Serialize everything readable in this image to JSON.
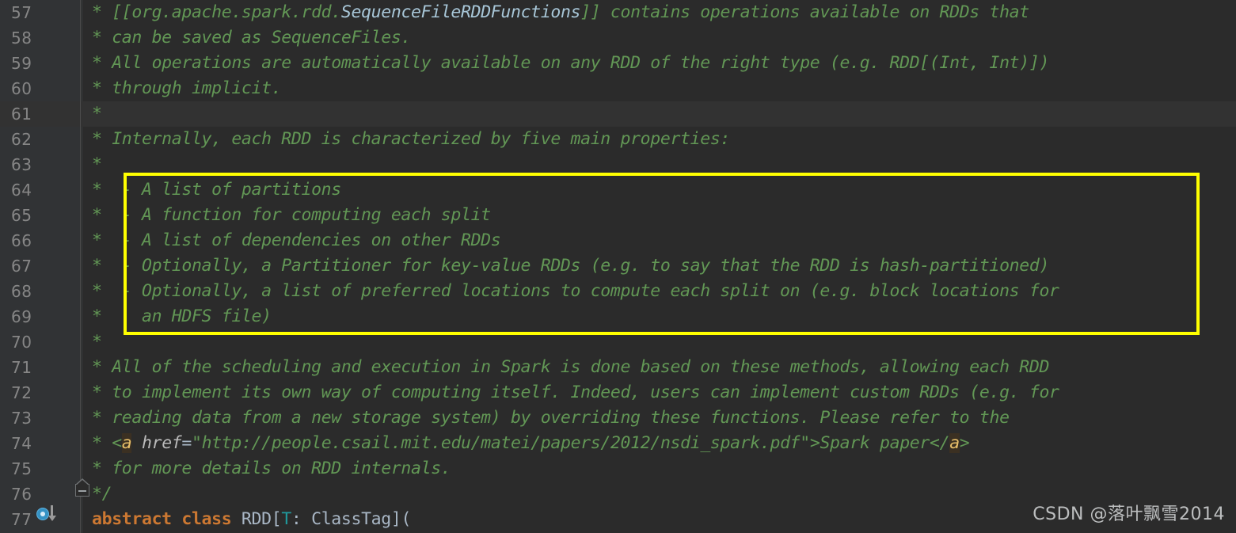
{
  "editor": {
    "background_color": "#2b2b2b",
    "gutter_color": "#313335",
    "current_line_color": "#323232",
    "comment_color": "#629755",
    "keyword_color": "#cc7832",
    "identifier_color": "#a9b7c6",
    "type_param_color": "#20999d",
    "highlight_box_color": "#ffff00",
    "first_line_number": 57,
    "last_line_number": 77,
    "current_line_number": 61
  },
  "lines": [
    {
      "no": "57",
      "text": "* [[org.apache.spark.rdd.SequenceFileRDDFunctions]] contains operations available on RDDs that"
    },
    {
      "no": "58",
      "text": "* can be saved as SequenceFiles."
    },
    {
      "no": "59",
      "text": "* All operations are automatically available on any RDD of the right type (e.g. RDD[(Int, Int)])"
    },
    {
      "no": "60",
      "text": "* through implicit."
    },
    {
      "no": "61",
      "text": "*"
    },
    {
      "no": "62",
      "text": "* Internally, each RDD is characterized by five main properties:"
    },
    {
      "no": "63",
      "text": "*"
    },
    {
      "no": "64",
      "text": "*  - A list of partitions"
    },
    {
      "no": "65",
      "text": "*  - A function for computing each split"
    },
    {
      "no": "66",
      "text": "*  - A list of dependencies on other RDDs"
    },
    {
      "no": "67",
      "text": "*  - Optionally, a Partitioner for key-value RDDs (e.g. to say that the RDD is hash-partitioned)"
    },
    {
      "no": "68",
      "text": "*  - Optionally, a list of preferred locations to compute each split on (e.g. block locations for"
    },
    {
      "no": "69",
      "text": "*    an HDFS file)"
    },
    {
      "no": "70",
      "text": "*"
    },
    {
      "no": "71",
      "text": "* All of the scheduling and execution in Spark is done based on these methods, allowing each RDD"
    },
    {
      "no": "72",
      "text": "* to implement its own way of computing itself. Indeed, users can implement custom RDDs (e.g. for"
    },
    {
      "no": "73",
      "text": "* reading data from a new storage system) by overriding these functions. Please refer to the"
    },
    {
      "no": "74",
      "text": "* <a href=\"http://people.csail.mit.edu/matei/papers/2012/nsdi_spark.pdf\">Spark paper</a>"
    },
    {
      "no": "75",
      "text": "* for more details on RDD internals."
    },
    {
      "no": "76",
      "text": "*/"
    },
    {
      "no": "77",
      "text": "abstract class RDD[T: ClassTag]("
    }
  ],
  "tokens": {
    "l57_a": "* [[",
    "l57_ref": "org.apache.spark.rdd.",
    "l57_type": "SequenceFileRDDFunctions",
    "l57_b": "]] contains operations available on RDDs that",
    "l58": "* can be saved as SequenceFiles.",
    "l59": "* All operations are automatically available on any RDD of the right type (e.g. RDD[(Int, Int)])",
    "l60": "* through implicit.",
    "l61": "*",
    "l62": "* Internally, each RDD is characterized by five main properties:",
    "l63": "*",
    "l64": "*  - A list of partitions",
    "l65": "*  - A function for computing each split",
    "l66": "*  - A list of dependencies on other RDDs",
    "l67": "*  - Optionally, a Partitioner for key-value RDDs (e.g. to say that the RDD is hash-partitioned)",
    "l68": "*  - Optionally, a list of preferred locations to compute each split on (e.g. block locations for",
    "l69": "*    an HDFS file)",
    "l70": "*",
    "l71": "* All of the scheduling and execution in Spark is done based on these methods, allowing each RDD",
    "l72": "* to implement its own way of computing itself. Indeed, users can implement custom RDDs (e.g. for",
    "l73": "* reading data from a new storage system) by overriding these functions. Please refer to the",
    "l74_a": "* <",
    "l74_tag1": "a",
    "l74_space": " ",
    "l74_attr": "href",
    "l74_eq": "=",
    "l74_url": "\"http://people.csail.mit.edu/matei/papers/2012/nsdi_spark.pdf\"",
    "l74_gt": ">Spark paper</",
    "l74_tag2": "a",
    "l74_end": ">",
    "l75": "* for more details on RDD internals.",
    "l76": "*/",
    "l77_kw": "abstract class ",
    "l77_name": "RDD[",
    "l77_tparam": "T",
    "l77_rest": ": ClassTag]("
  },
  "gutter_icons": {
    "implementation_marker_line": "77",
    "fold_marker_line": "76"
  },
  "watermark": {
    "text": "CSDN @落叶飘雪2014"
  },
  "highlight_box": {
    "covers_lines": "64-69",
    "color": "#ffff00"
  }
}
